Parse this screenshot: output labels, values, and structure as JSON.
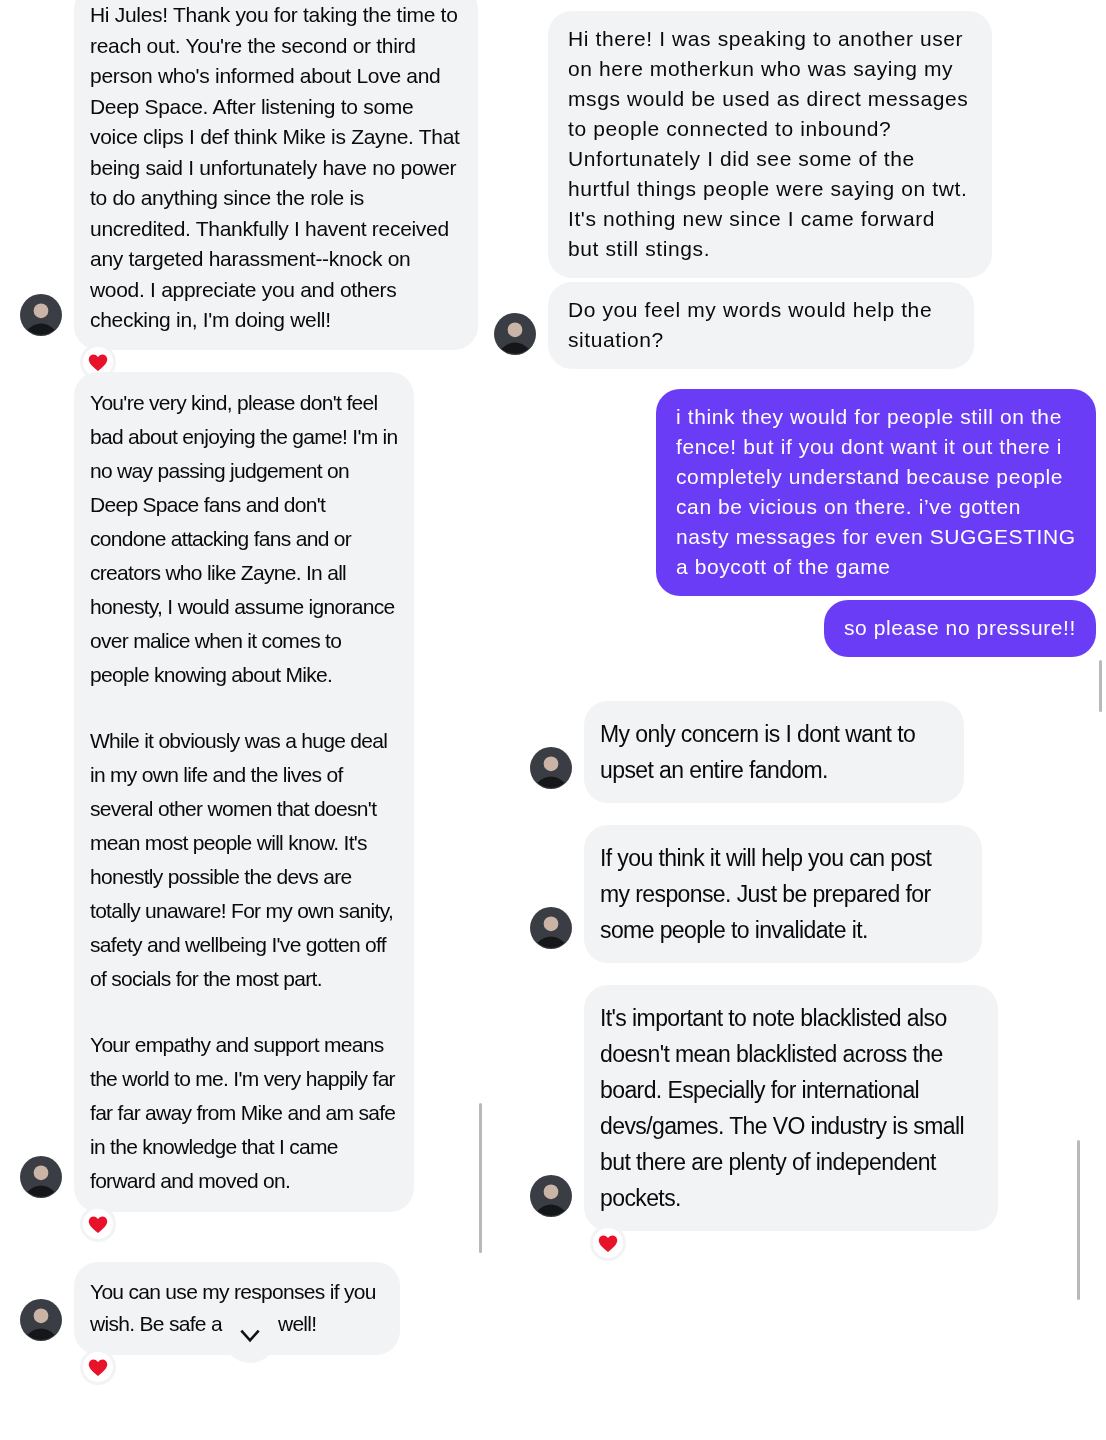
{
  "left_column": {
    "messages": [
      {
        "kind": "received",
        "paragraphs": [
          "Hi Jules! Thank you for taking the time to reach out. You're the second or third person who's informed about Love and Deep Space. After listening to some voice clips I def think Mike is Zayne. That being said I unfortunately have no power to do anything since the role is uncredited. Thankfully I havent received any targeted harassment--knock on wood. I appreciate you and others checking in, I'm doing well!"
        ],
        "avatar": true,
        "hearted": true
      },
      {
        "kind": "received",
        "paragraphs": [
          "You're very kind, please don't feel bad about enjoying the game! I'm in no way passing judgement on Deep Space fans and don't condone attacking fans and or creators who like Zayne. In all honesty, I would assume ignorance over malice when it comes to people knowing about Mike.",
          "While it obviously was a huge deal in my own life and the lives of several other women that doesn't mean most people will know. It's honestly possible the devs are totally unaware! For my own sanity, safety and wellbeing I've gotten off of socials for the most part.",
          "Your empathy and support means the world to me. I'm very happily far far far away from Mike and am safe in the knowledge that I came forward and moved on."
        ],
        "avatar": true,
        "hearted": true
      },
      {
        "kind": "received",
        "paragraphs": [
          "You can use my responses if you wish. Be safe a"
        ],
        "text_after_cover": "well!",
        "avatar": true,
        "hearted": true
      }
    ]
  },
  "right_column": {
    "messages": [
      {
        "kind": "received",
        "paragraphs": [
          "Hi there! I was speaking to another user on here motherkun who was saying my msgs would be used as direct messages to people connected to inbound? Unfortunately I did see some of the hurtful things people were saying on twt. It's nothing new since I came forward but still stings."
        ],
        "avatar": false,
        "hearted": false
      },
      {
        "kind": "received",
        "paragraphs": [
          "Do you feel my words would help the situation?"
        ],
        "avatar": true,
        "hearted": false
      },
      {
        "kind": "sent",
        "paragraphs": [
          "i think they would for people still on the fence! but if you dont want it out there i completely understand because people can be vicious on there. i’ve gotten nasty messages for even SUGGESTING a boycott of the game"
        ],
        "avatar": false,
        "hearted": false
      },
      {
        "kind": "sent",
        "paragraphs": [
          "so please no pressure!!"
        ],
        "avatar": false,
        "hearted": false
      },
      {
        "kind": "received",
        "paragraphs": [
          "My only concern is I dont want to upset an entire fandom."
        ],
        "avatar": true,
        "hearted": false
      },
      {
        "kind": "received",
        "paragraphs": [
          "If you think it will help you can post my response. Just be prepared for some people to invalidate it."
        ],
        "avatar": true,
        "hearted": false
      },
      {
        "kind": "received",
        "paragraphs": [
          "It's important to note blacklisted also doesn't mean blacklisted across the board. Especially for international devs/games. The VO industry is small but there are plenty of independent pockets."
        ],
        "avatar": true,
        "hearted": true
      }
    ]
  }
}
